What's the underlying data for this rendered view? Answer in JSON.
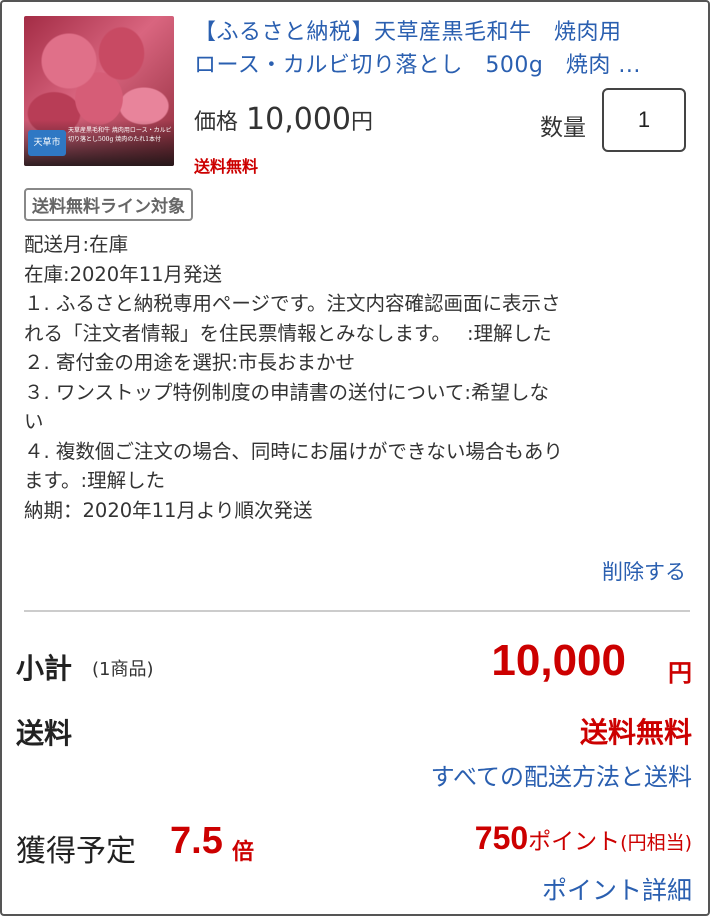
{
  "product": {
    "image_badge": "天草市",
    "image_caption": "天草産黒毛和牛 焼肉用ロース・カルビ切り落とし500g 焼肉のたれ1本付",
    "title_line1": "【ふるさと納税】天草産黒毛和牛　焼肉用",
    "title_line2": "ロース・カルビ切り落とし　500g　焼肉 ...",
    "price_label": "価格",
    "price_value": "10,000",
    "price_unit": "円",
    "free_shipping": "送料無料",
    "quantity_label": "数量",
    "quantity_value": "1",
    "shipping_line_badge": "送料無料ライン対象"
  },
  "options": [
    "配送月:在庫",
    "在庫:2020年11月発送",
    "１. ふるさと納税専用ページです。注文内容確認画面に表示さ",
    "れる「注文者情報」を住民票情報とみなします。　 :理解した",
    "２. 寄付金の用途を選択:市長おまかせ",
    "３. ワンストップ特例制度の申請書の送付について:希望しな",
    "い",
    "４. 複数個ご注文の場合、同時にお届けができない場合もあり",
    "ます。:理解した",
    "納期：2020年11月より順次発送"
  ],
  "delete_label": "削除する",
  "summary": {
    "subtotal_label": "小計",
    "subtotal_count": "(1商品)",
    "subtotal_value": "10,000",
    "subtotal_unit": "円",
    "shipping_label": "送料",
    "shipping_value": "送料無料",
    "shipping_link": "すべての配送方法と送料",
    "earn_label": "獲得予定",
    "earn_rate": "7.5",
    "earn_rate_unit": "倍",
    "points_value": "750",
    "points_text": "ポイント",
    "points_equiv": "(円相当)",
    "points_link": "ポイント詳細"
  },
  "colors": {
    "link": "#2a5fb0",
    "accent_red": "#cc0000"
  }
}
